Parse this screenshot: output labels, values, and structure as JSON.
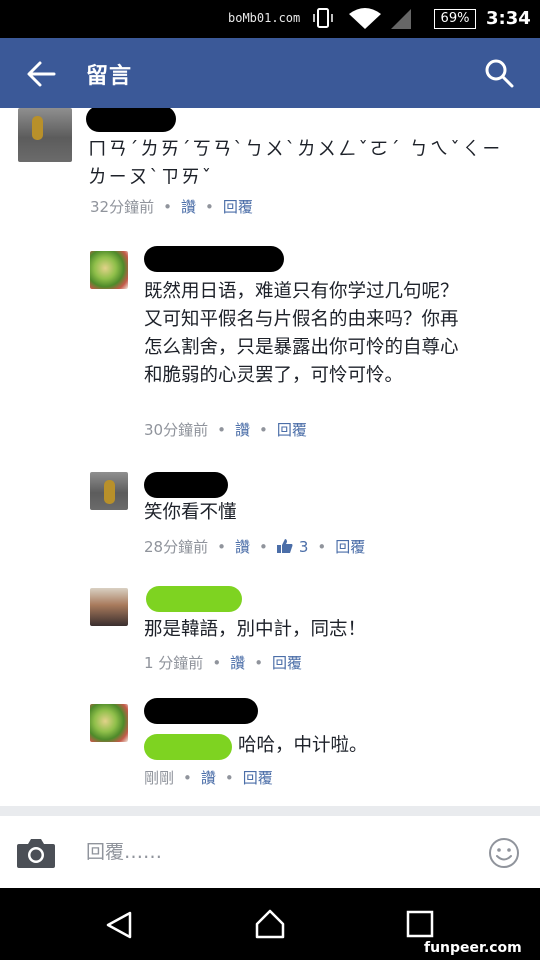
{
  "status_bar": {
    "carrier_text": "boMb01.com",
    "battery": "69%",
    "time": "3:34"
  },
  "header": {
    "title": "留言",
    "back_icon": "arrow-left-icon",
    "search_icon": "search-icon"
  },
  "comments": [
    {
      "text": "ㄇㄢˊㄌㄞˊㄎㄢˋㄅㄨˋㄌㄨㄥˇㄛˊ ㄅㄟˇㄑㄧ ㄌㄧㄡˋㄗㄞˇ",
      "time": "32分鐘前",
      "like_label": "讚",
      "reply_label": "回覆"
    },
    {
      "text": "既然用日语，难道只有你学过几句呢？又可知平假名与片假名的由来吗？你再怎么割舍，只是暴露出你可怜的自尊心和脆弱的心灵罢了，可怜可怜。",
      "time": "30分鐘前",
      "like_label": "讚",
      "reply_label": "回覆"
    },
    {
      "text": "笑你看不懂",
      "time": "28分鐘前",
      "like_label": "讚",
      "like_count": "3",
      "reply_label": "回覆"
    },
    {
      "text": "那是韓語，別中計，同志！",
      "time": "1 分鐘前",
      "like_label": "讚",
      "reply_label": "回覆"
    },
    {
      "text": "哈哈，中计啦。",
      "time": "剛剛",
      "like_label": "讚",
      "reply_label": "回覆"
    }
  ],
  "composer": {
    "placeholder": "回覆……"
  },
  "watermark": "funpeer.com",
  "colors": {
    "header": "#3b5998",
    "action_link": "#4b6ea8",
    "meta_gray": "#90949c",
    "redaction_green": "#7ed321"
  }
}
